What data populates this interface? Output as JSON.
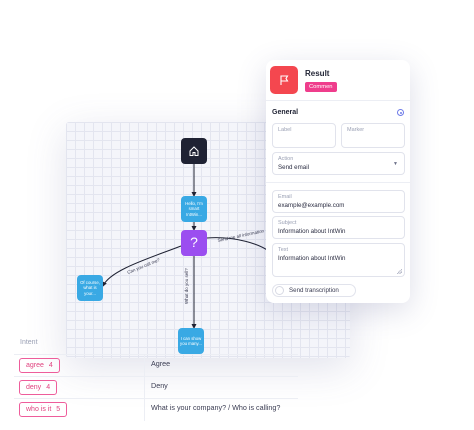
{
  "flow": {
    "start_icon": "home-icon",
    "node_hello": "Hello, I'm smart IntWin...",
    "node_question": "?",
    "node_left": "Of course, what is your...",
    "node_bottom": "I can show you many...",
    "edge_left_label": "Can you call me?",
    "edge_bottom_label": "What do you sell?",
    "edge_right_label": "Send me all information"
  },
  "intents": {
    "header": "Intent",
    "rows": [
      {
        "intent": "agree",
        "count": "4",
        "value": "Agree"
      },
      {
        "intent": "deny",
        "count": "4",
        "value": "Deny"
      },
      {
        "intent": "who is it",
        "count": "5",
        "value": "What is your company? / Who is calling?"
      }
    ]
  },
  "panel": {
    "icon": "flag-icon",
    "title": "Result",
    "badge": "Commen",
    "section": "General",
    "section_icon": "settings-circle-icon",
    "label_placeholder": "Label",
    "marker_placeholder": "Marker",
    "action_label": "Action",
    "action_value": "Send email",
    "email_label": "Email",
    "email_value": "example@example.com",
    "subject_label": "Subject",
    "subject_value": "Information about IntWin",
    "text_label": "Text",
    "text_value": "Information about IntWin",
    "toggle_label": "Send transcription"
  },
  "colors": {
    "accent_red": "#f4474f",
    "badge_pink": "#ef3d8c",
    "node_blue": "#39a9e4",
    "node_purple": "#9b4ef0",
    "node_dark": "#1f2233"
  }
}
